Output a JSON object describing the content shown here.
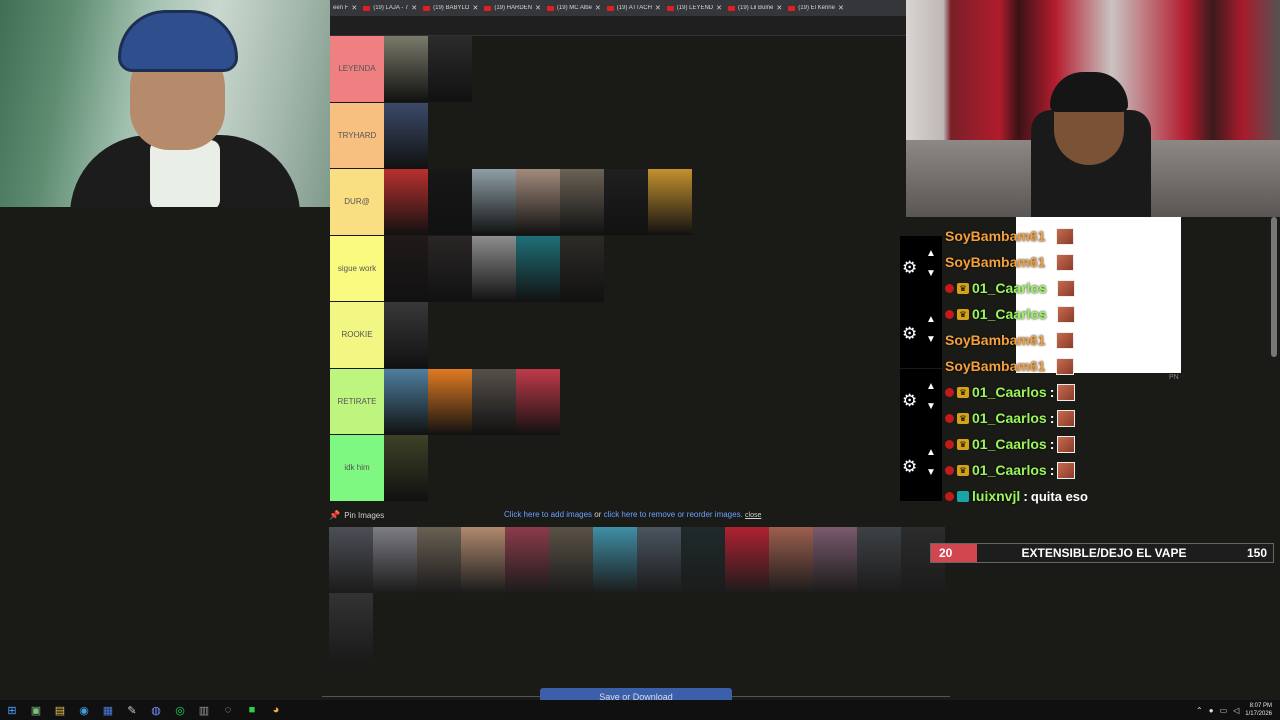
{
  "browser": {
    "tabs": [
      {
        "title": "een F"
      },
      {
        "title": "(19) LAJA - 7"
      },
      {
        "title": "(19) BABYLO"
      },
      {
        "title": "(19) HARDEN"
      },
      {
        "title": "(19) MC Albe"
      },
      {
        "title": "(19) ATTACH"
      },
      {
        "title": "(19) LEYEND"
      },
      {
        "title": "(19) Lil Bulne"
      },
      {
        "title": "(19) El Kenne"
      }
    ]
  },
  "tiers": [
    {
      "label": "LEYENDA",
      "color": "#f07f82",
      "items": [
        "#7a7a6a",
        "#2b2b2b"
      ]
    },
    {
      "label": "TRYHARD",
      "color": "#f7bf80",
      "items": [
        "#3b4a6a"
      ]
    },
    {
      "label": "DUR@",
      "color": "#f9de82",
      "items": [
        "#b8312e",
        "#171717",
        "#8fa0a6",
        "#a38b7c",
        "#6b6256",
        "#1f1f1f",
        "#c4912f"
      ]
    },
    {
      "label": "sigue work",
      "color": "#fbfa80",
      "items": [
        "#201a1a",
        "#2a2626",
        "#8d8d8d",
        "#1f6f77",
        "#2d2b26"
      ]
    },
    {
      "label": "ROOKIE",
      "color": "#f2f682",
      "items": [
        "#383838"
      ]
    },
    {
      "label": "RETIRATE",
      "color": "#bef57f",
      "items": [
        "#4e7f9f",
        "#e07b21",
        "#565049",
        "#c03a4a"
      ]
    },
    {
      "label": "idk him",
      "color": "#7ff882",
      "items": [
        "#3d4227"
      ]
    }
  ],
  "chat": {
    "messages": [
      {
        "user": "SoyBambam61",
        "sep": ":",
        "color": "#f4a03a",
        "badges": []
      },
      {
        "user": "SoyBambam61",
        "sep": ":",
        "color": "#f4a03a",
        "badges": []
      },
      {
        "user": "01_Caarlos",
        "sep": ":",
        "color": "#9bf55b",
        "badges": [
          "red",
          "crown"
        ]
      },
      {
        "user": "01_Caarlos",
        "sep": ":",
        "color": "#9bf55b",
        "badges": [
          "red",
          "crown"
        ]
      },
      {
        "user": "SoyBambam61",
        "sep": ":",
        "color": "#f4a03a",
        "badges": []
      },
      {
        "user": "SoyBambam61",
        "sep": ":",
        "color": "#f4a03a",
        "badges": []
      },
      {
        "user": "01_Caarlos",
        "sep": ":",
        "color": "#9bf55b",
        "badges": [
          "red",
          "crown"
        ]
      },
      {
        "user": "01_Caarlos",
        "sep": ":",
        "color": "#9bf55b",
        "badges": [
          "red",
          "crown"
        ]
      },
      {
        "user": "01_Caarlos",
        "sep": ":",
        "color": "#9bf55b",
        "badges": [
          "red",
          "crown"
        ]
      },
      {
        "user": "01_Caarlos",
        "sep": ":",
        "color": "#9bf55b",
        "badges": [
          "red",
          "crown"
        ]
      },
      {
        "user": "luixnvjl",
        "sep": ":",
        "color": "#9bf55b",
        "badges": [
          "red",
          "teal"
        ],
        "text": "quita eso"
      }
    ]
  },
  "pool": {
    "pin_label": "Pin Images",
    "info_add": "Click here to add images",
    "info_or": "or",
    "info_remove": "click here to remove or reorder images.",
    "info_close": "close",
    "items": [
      "#4c4f55",
      "#7d7d84",
      "#6a6053",
      "#b08a6e",
      "#8b3b4b",
      "#5a5246",
      "#3f8fa6",
      "#4a5560",
      "#1f2a2a",
      "#ae2231",
      "#9d5f4f",
      "#7a5a6d",
      "#3e4245",
      "#2c2c2c",
      "#333333"
    ],
    "save_label": "Save or Download"
  },
  "goal": {
    "current": "20",
    "title": "EXTENSIBLE/DEJO EL VAPE",
    "target": "150",
    "progress": 0.1333,
    "fill_color": "#d2464f"
  },
  "overlay": {
    "pn": "PN"
  },
  "taskbar": {
    "icons": [
      "windows-icon",
      "terminal-icon",
      "file-explorer-icon",
      "edge-icon",
      "store-icon",
      "pen-icon",
      "discord-icon",
      "spotify-icon",
      "console-icon",
      "obs-icon",
      "green-app-icon",
      "chrome-icon"
    ],
    "time": "8:07 PM",
    "date": "1/17/2026"
  }
}
